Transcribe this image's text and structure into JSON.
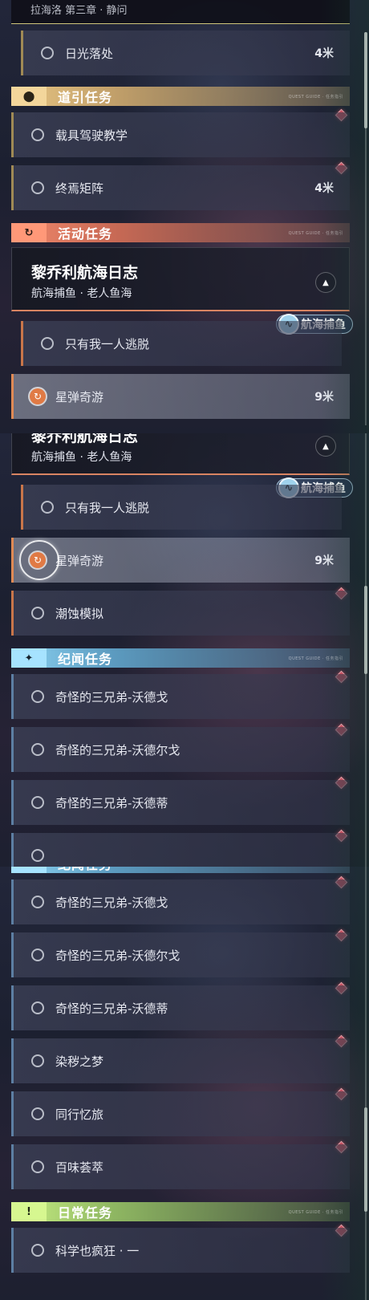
{
  "top_partial": {
    "text": "拉海洛 第三章 · 静问"
  },
  "distance_unit": "米",
  "categories": {
    "guide": {
      "label": "道引任务",
      "icon": "location-pin-icon"
    },
    "activity": {
      "label": "活动任务",
      "icon": "activity-cycle-icon"
    },
    "chronicle": {
      "label": "纪闻任务",
      "icon": "sparkle-star-icon"
    },
    "daily": {
      "label": "日常任务",
      "icon": "exclamation-box-icon"
    }
  },
  "category_tag": "QUEST GUIDE · 任务指引",
  "card": {
    "title": "黎乔利航海日志",
    "subtitle": "航海捕鱼 · 老人鱼海",
    "badge": "航海捕鱼"
  },
  "quests": {
    "sunlight": {
      "label": "日光落处",
      "distance": "4米"
    },
    "vehicle": {
      "label": "载具驾驶教学"
    },
    "matrix": {
      "label": "终焉矩阵",
      "distance": "4米"
    },
    "escape": {
      "label": "只有我一人逃脱"
    },
    "star": {
      "label": "星弹奇游",
      "distance": "9米"
    },
    "tide": {
      "label": "潮蚀模拟"
    },
    "bro1": {
      "label": "奇怪的三兄弟-沃德戈"
    },
    "bro2": {
      "label": "奇怪的三兄弟-沃德尔戈"
    },
    "bro3": {
      "label": "奇怪的三兄弟-沃德蒂"
    },
    "dye": {
      "label": "染秽之梦"
    },
    "memory": {
      "label": "同行忆旅"
    },
    "flavor": {
      "label": "百味荟萃"
    },
    "science": {
      "label": "科学也疯狂 · 一"
    }
  },
  "colors": {
    "guide": "#e7c583",
    "activity": "#f0886b",
    "chronicle": "#8cd3f2",
    "daily": "#c8ef83",
    "marker": "#e2566c",
    "active": "#e07a45"
  }
}
